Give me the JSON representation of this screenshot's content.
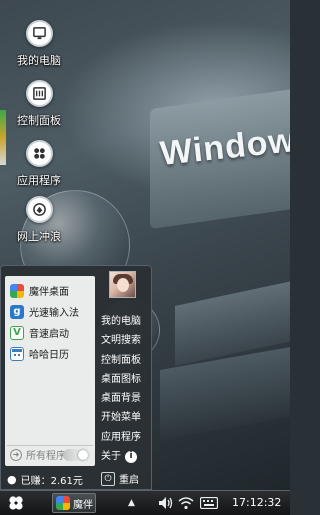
{
  "wallpaper": {
    "brand_text": "Window"
  },
  "desktop": {
    "icons": [
      {
        "label": "我的电脑",
        "icon": "computer-icon"
      },
      {
        "label": "控制面板",
        "icon": "control-panel-icon"
      },
      {
        "label": "应用程序",
        "icon": "apps-icon"
      },
      {
        "label": "网上冲浪",
        "icon": "browser-icon"
      }
    ]
  },
  "start_menu": {
    "apps": [
      {
        "label": "魔伴桌面",
        "icon": "mobon-desktop-icon",
        "color": "#e94b3c"
      },
      {
        "label": "光速输入法",
        "icon": "input-method-icon",
        "color": "#2a79c9"
      },
      {
        "label": "音速启动",
        "icon": "launcher-icon",
        "color": "#3aa84a"
      },
      {
        "label": "哈哈日历",
        "icon": "calendar-icon",
        "color": "#3a7fc4"
      }
    ],
    "all_programs_label": "所有程序",
    "right_links": [
      "我的电脑",
      "文明搜索",
      "控制面板",
      "桌面图标",
      "桌面背景",
      "开始菜单",
      "应用程序"
    ],
    "about_label": "关于",
    "earnings_label": "已赚：2.61元",
    "restart_label": "重启"
  },
  "taskbar": {
    "task_label": "魔伴",
    "clock": "17:12:32"
  },
  "colors": {
    "menu_bg": "#2b3034",
    "apps_panel_bg": "#e9ecea",
    "taskbar_bg": "#121415"
  }
}
